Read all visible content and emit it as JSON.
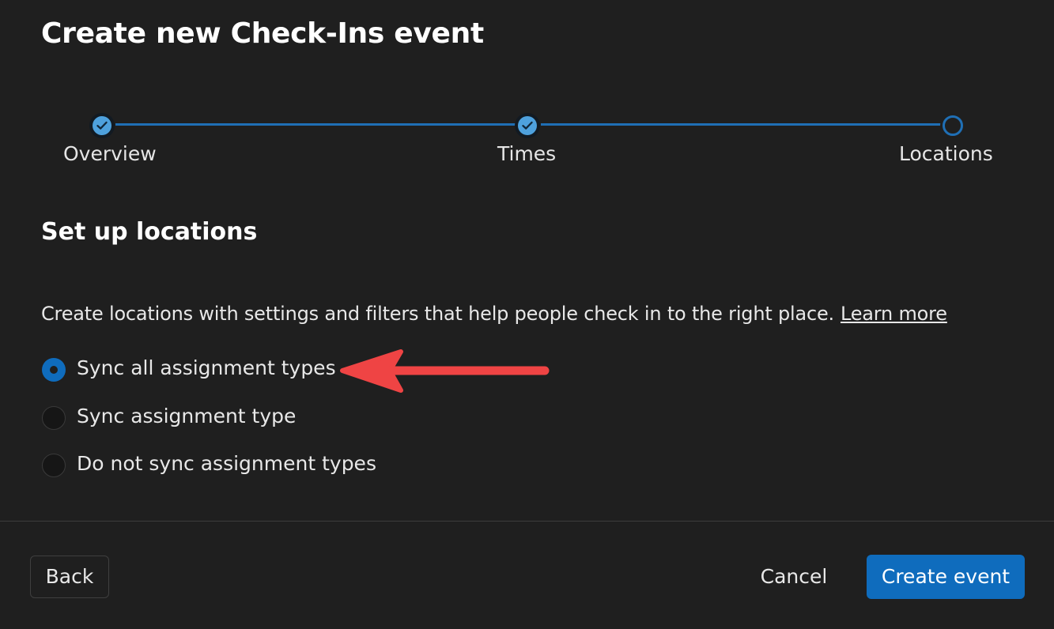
{
  "dialog": {
    "title": "Create new Check-Ins event"
  },
  "stepper": {
    "steps": [
      {
        "label": "Overview",
        "state": "completed"
      },
      {
        "label": "Times",
        "state": "completed"
      },
      {
        "label": "Locations",
        "state": "current"
      }
    ]
  },
  "section": {
    "title": "Set up locations",
    "description": "Create locations with settings and filters that help people check in to the right place.",
    "learn_more": "Learn more"
  },
  "sync_options": {
    "selected": "Sync all assignment types",
    "options": [
      {
        "label": "Sync all assignment types",
        "checked": true
      },
      {
        "label": "Sync assignment type",
        "checked": false
      },
      {
        "label": "Do not sync assignment types",
        "checked": false
      }
    ]
  },
  "annotation": {
    "icon": "red-arrow-icon",
    "color": "#ef4444"
  },
  "footer": {
    "back_label": "Back",
    "cancel_label": "Cancel",
    "create_label": "Create event"
  },
  "colors": {
    "accent": "#0f6cbd",
    "step_complete": "#4ea1dd",
    "background": "#1f1f1f"
  }
}
